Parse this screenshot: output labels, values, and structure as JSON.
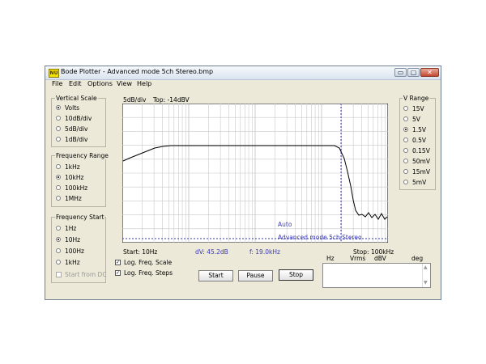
{
  "window": {
    "title": "Bode Plotter - Advanced mode 5ch Stereo.bmp",
    "app_badge": "NU"
  },
  "window_buttons": {
    "minimize": "▭",
    "maximize": "▢",
    "close": "✕"
  },
  "menu": [
    "File",
    "Edit",
    "Options",
    "View",
    "Help"
  ],
  "vertical_scale": {
    "title": "Vertical Scale",
    "options": [
      "Volts",
      "10dB/div",
      "5dB/div",
      "1dB/div"
    ],
    "selected": "Volts"
  },
  "frequency_range": {
    "title": "Frequency Range",
    "options": [
      "1kHz",
      "10kHz",
      "100kHz",
      "1MHz"
    ],
    "selected": "10kHz"
  },
  "frequency_start": {
    "title": "Frequency Start",
    "options": [
      "1Hz",
      "10Hz",
      "100Hz",
      "1kHz"
    ],
    "selected": "10Hz",
    "start_from_dc": "Start from DC"
  },
  "v_range": {
    "title": "V Range",
    "options": [
      "15V",
      "5V",
      "1.5V",
      "0.5V",
      "0.15V",
      "50mV",
      "15mV",
      "5mV"
    ],
    "selected": "1.5V"
  },
  "plot": {
    "scale_label": "5dB/div",
    "top_label": "Top: -14dBV",
    "start_label": "Start: 10Hz",
    "stop_label": "Stop: 100kHz",
    "dv_label": "dV: 45.2dB",
    "f_label": "f: 19.0kHz",
    "auto_label": "Auto",
    "mode_label": "Advanced mode 5ch Stereo",
    "curve_color": "#000000",
    "grid_color": "#c8c8c8",
    "cursor_color": "#3a3ab8"
  },
  "checkboxes": [
    {
      "label": "Log. Freq. Scale",
      "checked": true
    },
    {
      "label": "Log. Freq. Steps",
      "checked": true
    }
  ],
  "buttons": {
    "start": "Start",
    "pause": "Pause",
    "stop": "Stop"
  },
  "readout_headers": [
    "Hz",
    "Vrms",
    "dBV",
    "deg"
  ],
  "scroll_arrows": {
    "up": "▲",
    "down": "▼"
  }
}
